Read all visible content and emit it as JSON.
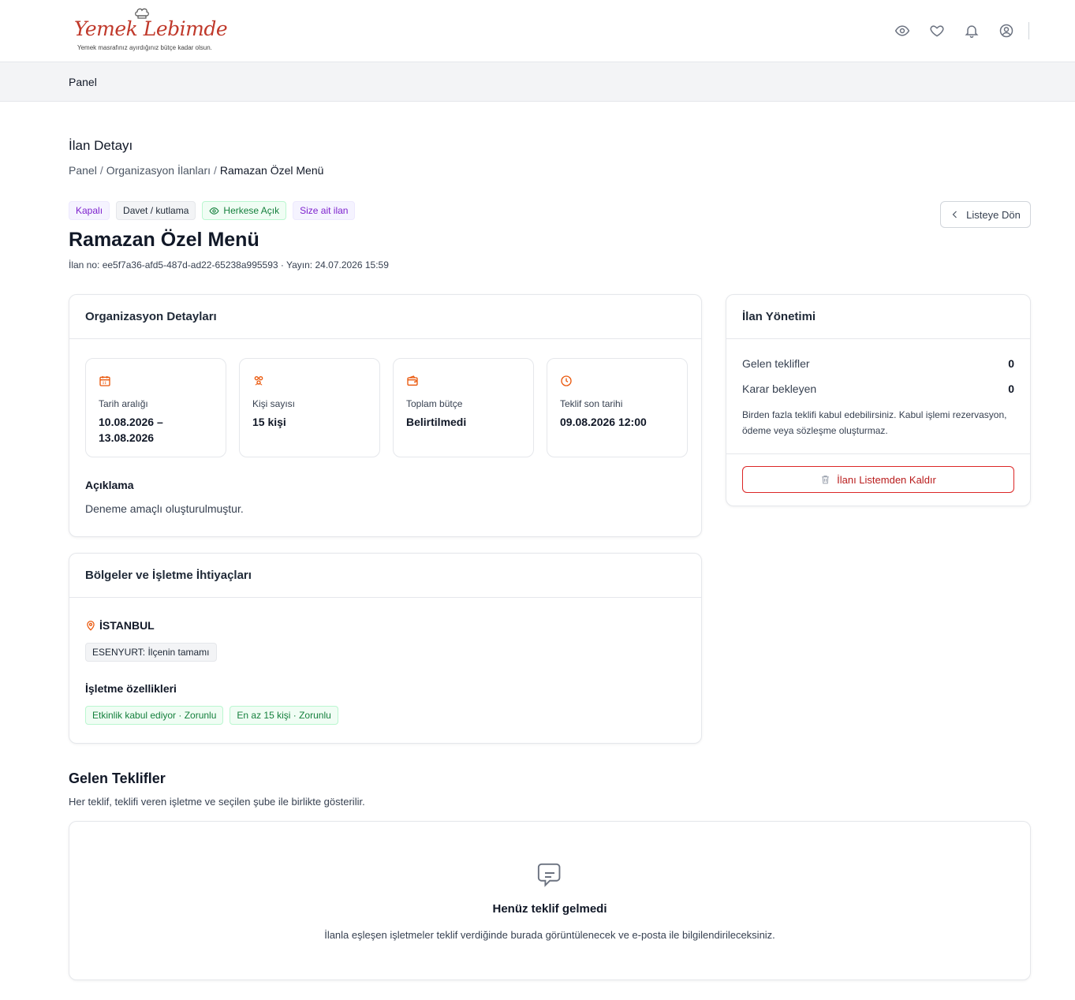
{
  "brand": {
    "logo_text": "Yemek Lebimde",
    "tagline": "Yemek masrafınız ayırdığınız bütçe kadar olsun.",
    "color": "#c0392b"
  },
  "header": {
    "icons": [
      "eye-icon",
      "heart-icon",
      "bell-icon",
      "user-circle-icon"
    ]
  },
  "subnav": {
    "panel": "Panel"
  },
  "page": {
    "title": "İlan Detayı",
    "breadcrumb": {
      "home": "Panel",
      "sep": "/",
      "section": "Organizasyon İlanları",
      "current": "Ramazan Özel Menü"
    }
  },
  "listing": {
    "badges": {
      "status": "Kapalı",
      "category": "Davet / kutlama",
      "visibility": "Herkese Açık",
      "owner": "Size ait ilan"
    },
    "back_label": "Listeye Dön",
    "title": "Ramazan Özel Menü",
    "meta": "İlan no: ee5f7a36-afd5-487d-ad22-65238a995593 · Yayın: 24.07.2026 15:59"
  },
  "org_details": {
    "heading": "Organizasyon Detayları",
    "stats": [
      {
        "icon": "calendar-icon",
        "label": "Tarih aralığı",
        "value": "10.08.2026 – 13.08.2026"
      },
      {
        "icon": "people-icon",
        "label": "Kişi sayısı",
        "value": "15 kişi"
      },
      {
        "icon": "wallet-icon",
        "label": "Toplam bütçe",
        "value": "Belirtilmedi"
      },
      {
        "icon": "clock-icon",
        "label": "Teklif son tarihi",
        "value": "09.08.2026 12:00"
      }
    ],
    "description_title": "Açıklama",
    "description": "Deneme amaçlı oluşturulmuştur."
  },
  "regions": {
    "heading": "Bölgeler ve İşletme İhtiyaçları",
    "city": "İSTANBUL",
    "district": "ESENYURT: İlçenin tamamı",
    "features_title": "İşletme özellikleri",
    "features": [
      "Etkinlik kabul ediyor · Zorunlu",
      "En az 15 kişi · Zorunlu"
    ]
  },
  "management": {
    "heading": "İlan Yönetimi",
    "incoming_label": "Gelen teklifler",
    "incoming_count": "0",
    "pending_label": "Karar bekleyen",
    "pending_count": "0",
    "note": "Birden fazla teklifi kabul edebilirsiniz. Kabul işlemi rezervasyon, ödeme veya sözleşme oluşturmaz.",
    "remove_label": "İlanı Listemden Kaldır"
  },
  "offers": {
    "title": "Gelen Teklifler",
    "subtitle": "Her teklif, teklifi veren işletme ve seçilen şube ile birlikte gösterilir.",
    "empty_title": "Henüz teklif gelmedi",
    "empty_text": "İlanla eşleşen işletmeler teklif verdiğinde burada görüntülenecek ve e-posta ile bilgilendirileceksiniz."
  },
  "colors": {
    "accent_orange": "#ea580c",
    "danger": "#dc2626",
    "success": "#15803d",
    "purple": "#7e22ce"
  }
}
